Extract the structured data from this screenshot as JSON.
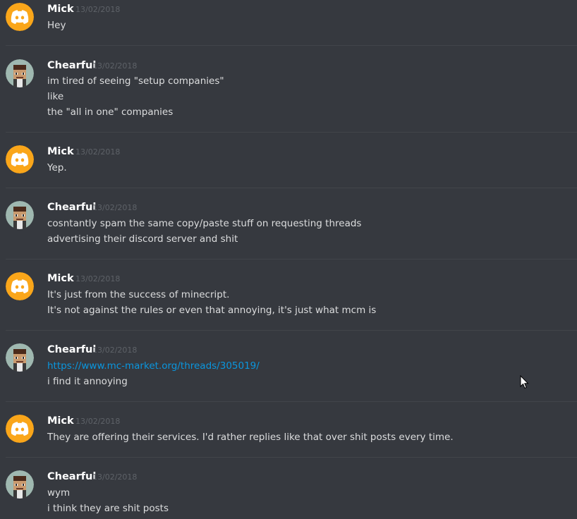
{
  "colors": {
    "background": "#36393f",
    "text": "#dcddde",
    "username": "#ffffff",
    "timestamp": "#5e6268",
    "link": "#0a96de",
    "divider": "#42454a",
    "mick_avatar": "#faa61a",
    "chearful_avatar_bg": "#9fb8b0"
  },
  "icons": {
    "mick_avatar": "discord-logo-icon",
    "chearful_avatar": "character-avatar-icon",
    "cursor": "mouse-pointer-icon"
  },
  "messages": [
    {
      "author": "Mick",
      "timestamp": "13/02/2018",
      "lines": [
        "Hey"
      ]
    },
    {
      "author": "Chearful",
      "timestamp": "13/02/2018",
      "lines": [
        "im tired of seeing \"setup companies\"",
        "like",
        "the \"all in one\" companies"
      ]
    },
    {
      "author": "Mick",
      "timestamp": "13/02/2018",
      "lines": [
        "Yep."
      ]
    },
    {
      "author": "Chearful",
      "timestamp": "13/02/2018",
      "lines": [
        "cosntantly spam the same copy/paste stuff on requesting threads",
        "advertising their discord server and shit"
      ]
    },
    {
      "author": "Mick",
      "timestamp": "13/02/2018",
      "lines": [
        "It's just from the success of minecript.",
        "It's not against the rules or even that annoying, it's just what mcm is"
      ]
    },
    {
      "author": "Chearful",
      "timestamp": "13/02/2018",
      "lines": [
        "https://www.mc-market.org/threads/305019/",
        "i find it annoying"
      ]
    },
    {
      "author": "Mick",
      "timestamp": "13/02/2018",
      "lines": [
        "They are offering their services. I'd rather replies like that over shit posts every time."
      ]
    },
    {
      "author": "Chearful",
      "timestamp": "13/02/2018",
      "lines": [
        "wym",
        "i think they are shit posts"
      ]
    }
  ]
}
